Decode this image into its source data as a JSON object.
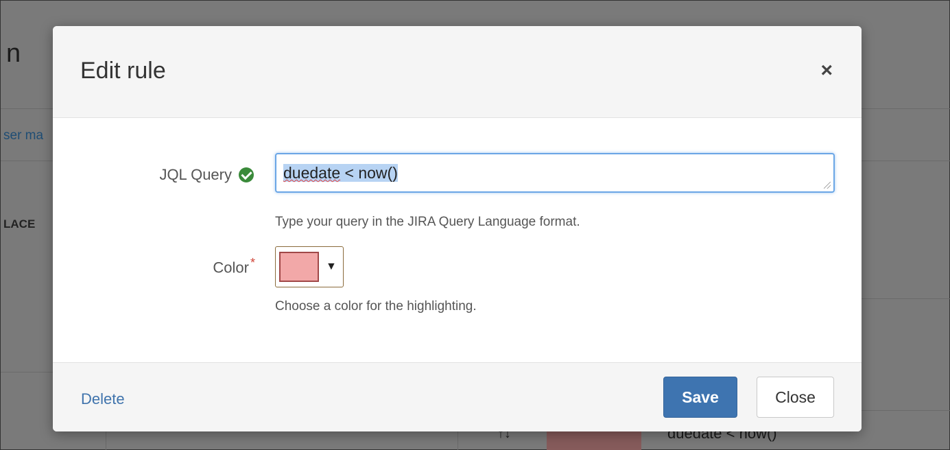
{
  "background": {
    "title_fragment": "n",
    "link_fragment": "ser ma",
    "header_fragment": "LACE",
    "row_query": "duedate < now()",
    "sort_glyph": "↑↓",
    "row_color": "#865b5b"
  },
  "modal": {
    "title": "Edit rule",
    "close_glyph": "×",
    "jql": {
      "label": "JQL Query",
      "valid_icon": "check-circle-icon",
      "value_word": "duedate",
      "value_rest": " < now()",
      "help": "Type your query in the JIRA Query Language format."
    },
    "color": {
      "label": "Color",
      "required_marker": "*",
      "selected_color": "#f2a8a8",
      "caret": "▼",
      "help": "Choose a color for the highlighting."
    },
    "footer": {
      "delete_label": "Delete",
      "save_label": "Save",
      "close_label": "Close"
    }
  },
  "colors": {
    "primary": "#3e74b0",
    "link": "#3f73ac",
    "valid": "#3a8a3a",
    "required": "#d04437",
    "focus": "#6aa6e6"
  }
}
